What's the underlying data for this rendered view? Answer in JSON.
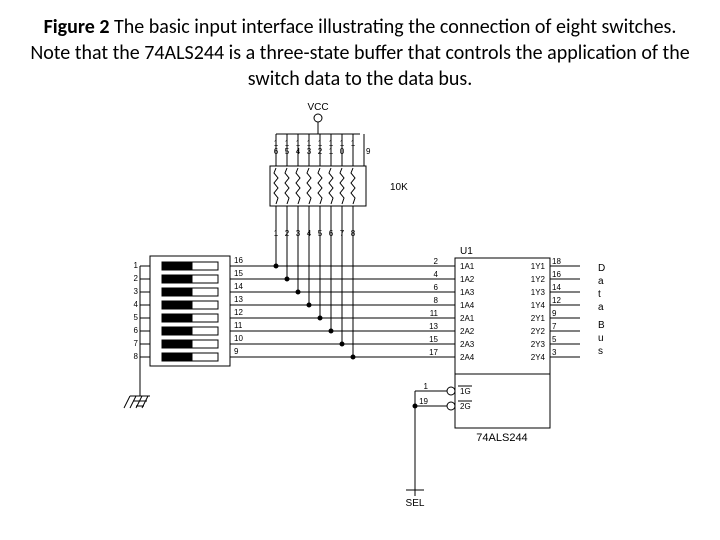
{
  "caption": {
    "figlabel": "Figure 2",
    "text": "  The basic input interface illustrating the connection of eight switches. Note that the 74ALS244 is a three-state buffer that controls the application of the switch data to the data bus."
  },
  "labels": {
    "vcc": "VCC",
    "res_value": "10K",
    "ic_ref": "U1",
    "ic_name": "74ALS244",
    "sel": "SEL",
    "bus_word": "Data Bus",
    "res_top_pins": [
      "1",
      "1",
      "1",
      "1",
      "1",
      "1",
      "1",
      "1",
      ""
    ],
    "res_top_pins2": [
      "6",
      "5",
      "4",
      "3",
      "2",
      "1",
      "0",
      "",
      "9"
    ],
    "res_bot_pins": [
      "1",
      "2",
      "3",
      "4",
      "5",
      "6",
      "7",
      "8"
    ],
    "dip_left": [
      "1",
      "2",
      "3",
      "4",
      "5",
      "6",
      "7",
      "8"
    ],
    "dip_right": [
      "16",
      "15",
      "14",
      "13",
      "12",
      "11",
      "10",
      "9"
    ],
    "ic_left_pins": [
      "2",
      "4",
      "6",
      "8",
      "11",
      "13",
      "15",
      "17"
    ],
    "ic_left_names": [
      "1A1",
      "1A2",
      "1A3",
      "1A4",
      "2A1",
      "2A2",
      "2A3",
      "2A4"
    ],
    "ic_right_names": [
      "1Y1",
      "1Y2",
      "1Y3",
      "1Y4",
      "2Y1",
      "2Y2",
      "2Y3",
      "2Y4"
    ],
    "ic_right_pins": [
      "18",
      "16",
      "14",
      "12",
      "9",
      "7",
      "5",
      "3"
    ],
    "ic_en_pins": [
      "1",
      "19"
    ],
    "ic_en_names": [
      "1G",
      "2G"
    ]
  }
}
